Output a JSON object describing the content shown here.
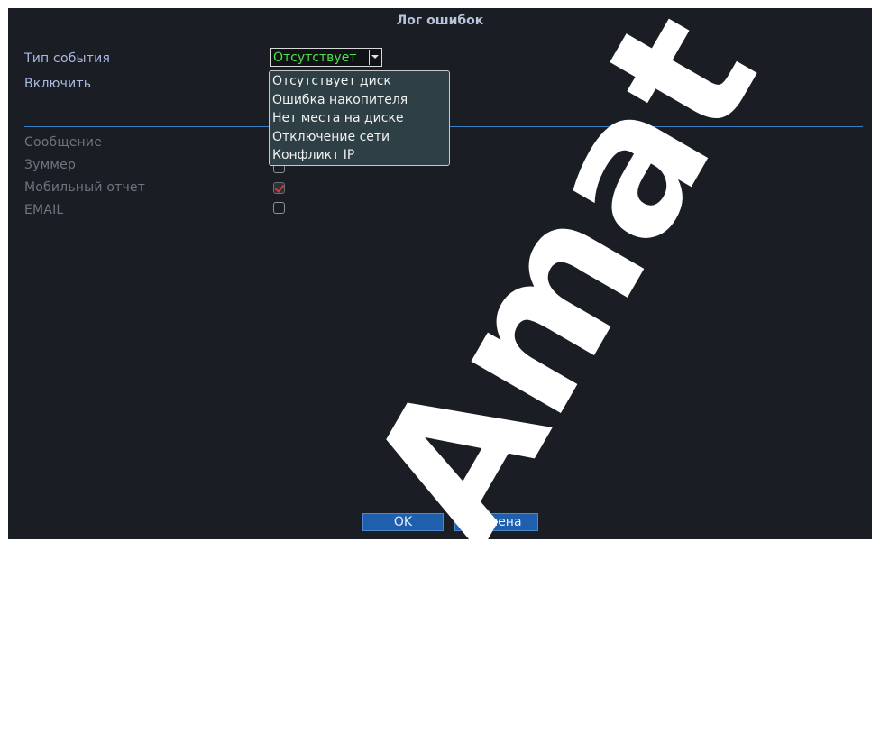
{
  "window": {
    "title": "Лог ошибок"
  },
  "form": {
    "event_type_label": "Тип события",
    "event_type_value": "Отсутствует",
    "enable_label": "Включить"
  },
  "dropdown": {
    "options": [
      "Отсутствует диск",
      "Ошибка накопителя",
      "Нет места на диске",
      "Отключение сети",
      "Конфликт IP"
    ]
  },
  "actions": [
    {
      "label": "Сообщение",
      "checked": false
    },
    {
      "label": "Зуммер",
      "checked": false
    },
    {
      "label": "Мобильный отчет",
      "checked": true
    },
    {
      "label": "EMAIL",
      "checked": false
    }
  ],
  "buttons": {
    "ok": "OK",
    "cancel": "Отмена"
  },
  "watermark": {
    "text": "Amat"
  },
  "colors": {
    "panel_bg": "#1a1d23",
    "selected_text": "#4ee04a",
    "divider": "#3a7fc4",
    "button_bg": "#1f5fae",
    "checkmark": "#d23a3a"
  }
}
